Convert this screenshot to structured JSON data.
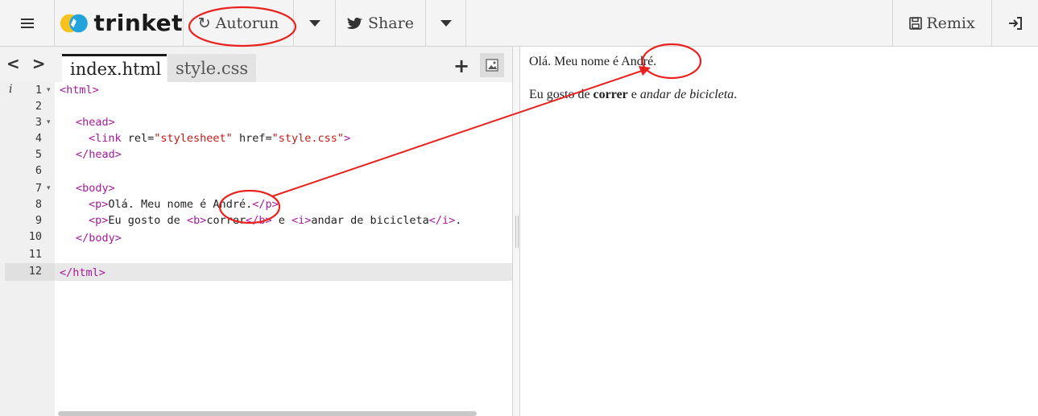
{
  "toolbar": {
    "brand": "trinket",
    "autorun_label": "Autorun",
    "share_label": "Share",
    "remix_label": "Remix"
  },
  "editor": {
    "tabs": [
      {
        "label": "index.html",
        "active": true
      },
      {
        "label": "style.css",
        "active": false
      }
    ],
    "lines": [
      {
        "num": "1",
        "fold": true
      },
      {
        "num": "2",
        "fold": false
      },
      {
        "num": "3",
        "fold": true
      },
      {
        "num": "4",
        "fold": false
      },
      {
        "num": "5",
        "fold": false
      },
      {
        "num": "6",
        "fold": false
      },
      {
        "num": "7",
        "fold": true
      },
      {
        "num": "8",
        "fold": false
      },
      {
        "num": "9",
        "fold": false
      },
      {
        "num": "10",
        "fold": false
      },
      {
        "num": "11",
        "fold": false
      },
      {
        "num": "12",
        "fold": false
      }
    ],
    "info_marker": "i",
    "code": {
      "l1_tag": "<html>",
      "l3_tag": "<head>",
      "l4_tag_open": "<link",
      "l4_attr_rel": " rel=",
      "l4_val_rel": "\"stylesheet\"",
      "l4_attr_href": " href=",
      "l4_val_href": "\"style.css\"",
      "l4_tag_close": ">",
      "l5_tag": "</head>",
      "l7_tag": "<body>",
      "l8_p_open": "<p>",
      "l8_text": "Olá. Meu nome é André.",
      "l8_p_close": "</p>",
      "l9_p_open": "<p>",
      "l9_text1": "Eu gosto de ",
      "l9_b_open": "<b>",
      "l9_b_text": "correr",
      "l9_b_close": "</b>",
      "l9_text2": " e ",
      "l9_i_open": "<i>",
      "l9_i_text": "andar de bicicleta",
      "l9_i_close": "</i>",
      "l9_tail": ".",
      "l10_tag": "</body>",
      "l12_tag": "</html>"
    }
  },
  "output": {
    "p1": "Olá. Meu nome é André.",
    "p2_text1": "Eu gosto de ",
    "p2_bold": "correr",
    "p2_text2": " e ",
    "p2_italic": "andar de bicicleta",
    "p2_tail": "."
  },
  "colors": {
    "annotation": "#e8231f",
    "tag": "#a6199c",
    "string": "#c41a16",
    "logo_yellow": "#f7c21b",
    "logo_blue": "#22a3dc"
  }
}
